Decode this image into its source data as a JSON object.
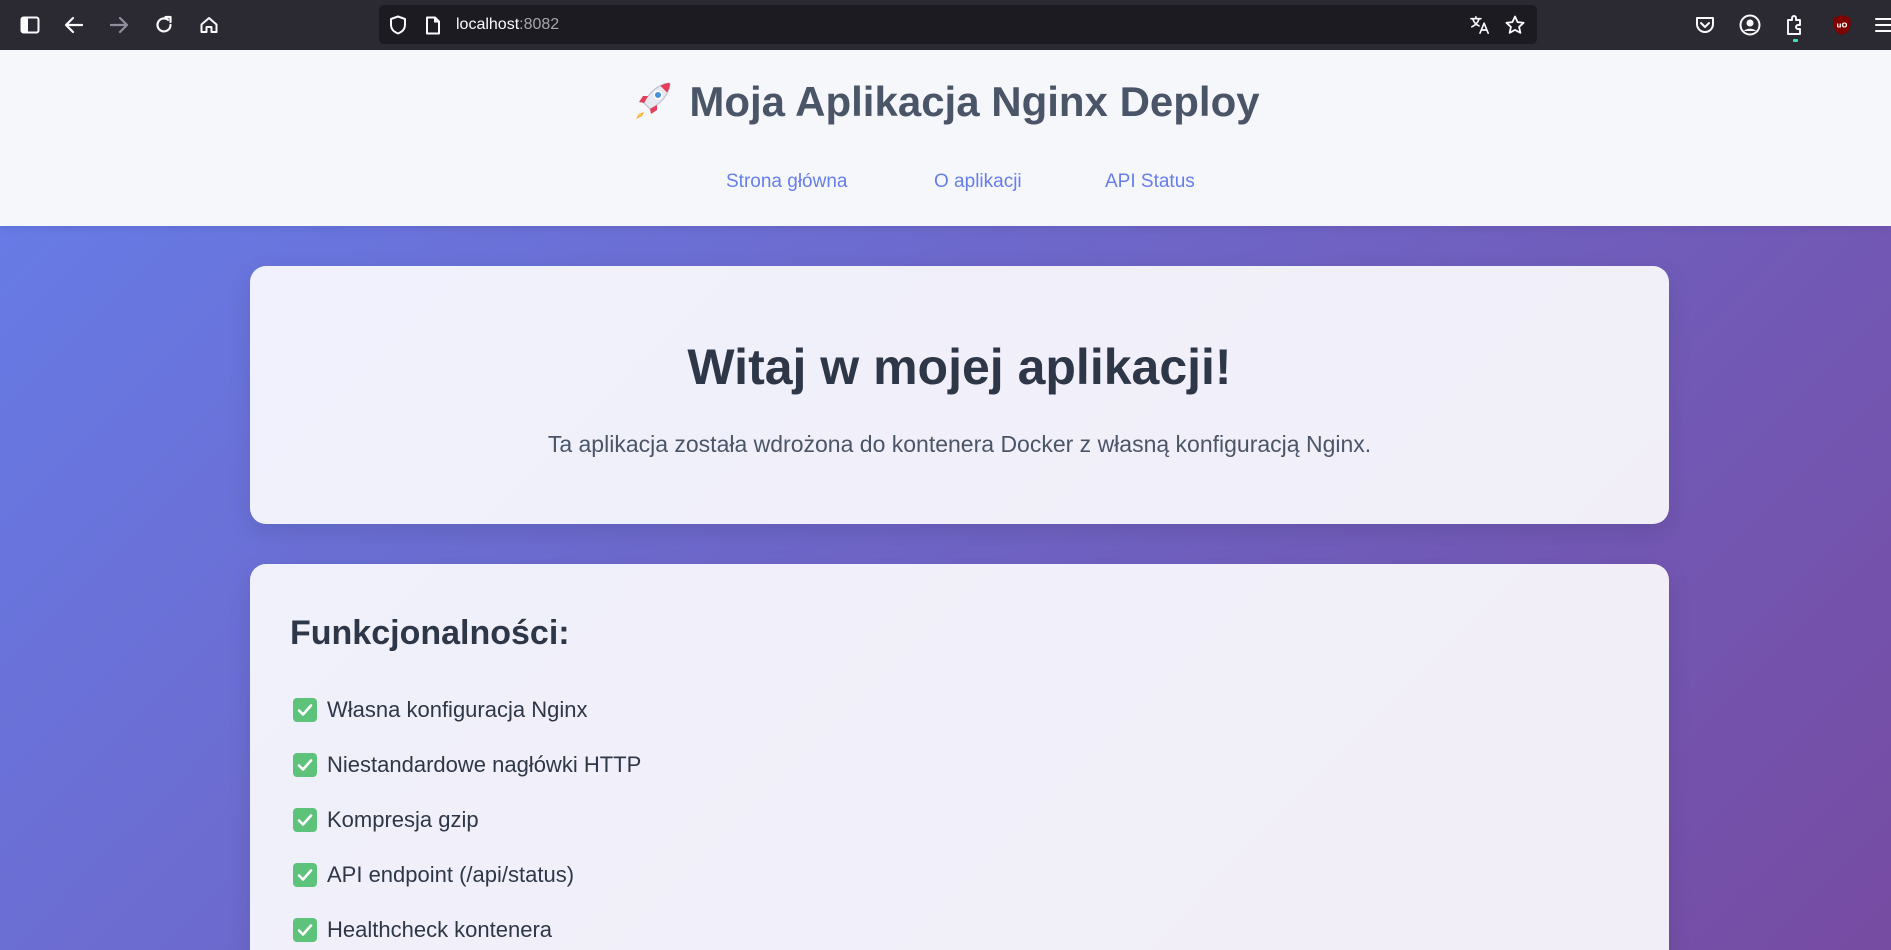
{
  "browser": {
    "url_host": "localhost",
    "url_port": ":8082",
    "icons": [
      "sidebar-icon",
      "back-icon",
      "forward-icon",
      "reload-icon",
      "home-icon",
      "shield-icon",
      "page-icon",
      "translate-icon",
      "star-icon",
      "pocket-icon",
      "account-icon",
      "extensions-icon",
      "ublock-icon",
      "menu-icon"
    ]
  },
  "header": {
    "title": "Moja Aplikacja Nginx Deploy",
    "nav": [
      {
        "label": "Strona główna"
      },
      {
        "label": "O aplikacji"
      },
      {
        "label": "API Status"
      }
    ]
  },
  "hero": {
    "title": "Witaj w mojej aplikacji!",
    "subtitle": "Ta aplikacja została wdrożona do kontenera Docker z własną konfiguracją Nginx."
  },
  "features": {
    "title": "Funkcjonalności:",
    "items": [
      {
        "label": "Własna konfiguracja Nginx"
      },
      {
        "label": "Niestandardowe nagłówki HTTP"
      },
      {
        "label": "Kompresja gzip"
      },
      {
        "label": "API endpoint (/api/status)"
      },
      {
        "label": "Healthcheck kontenera"
      }
    ]
  },
  "colors": {
    "accent": "#667eea",
    "gradient_end": "#764ba2",
    "title_text": "#2d3748",
    "check": "#5ec37a"
  }
}
